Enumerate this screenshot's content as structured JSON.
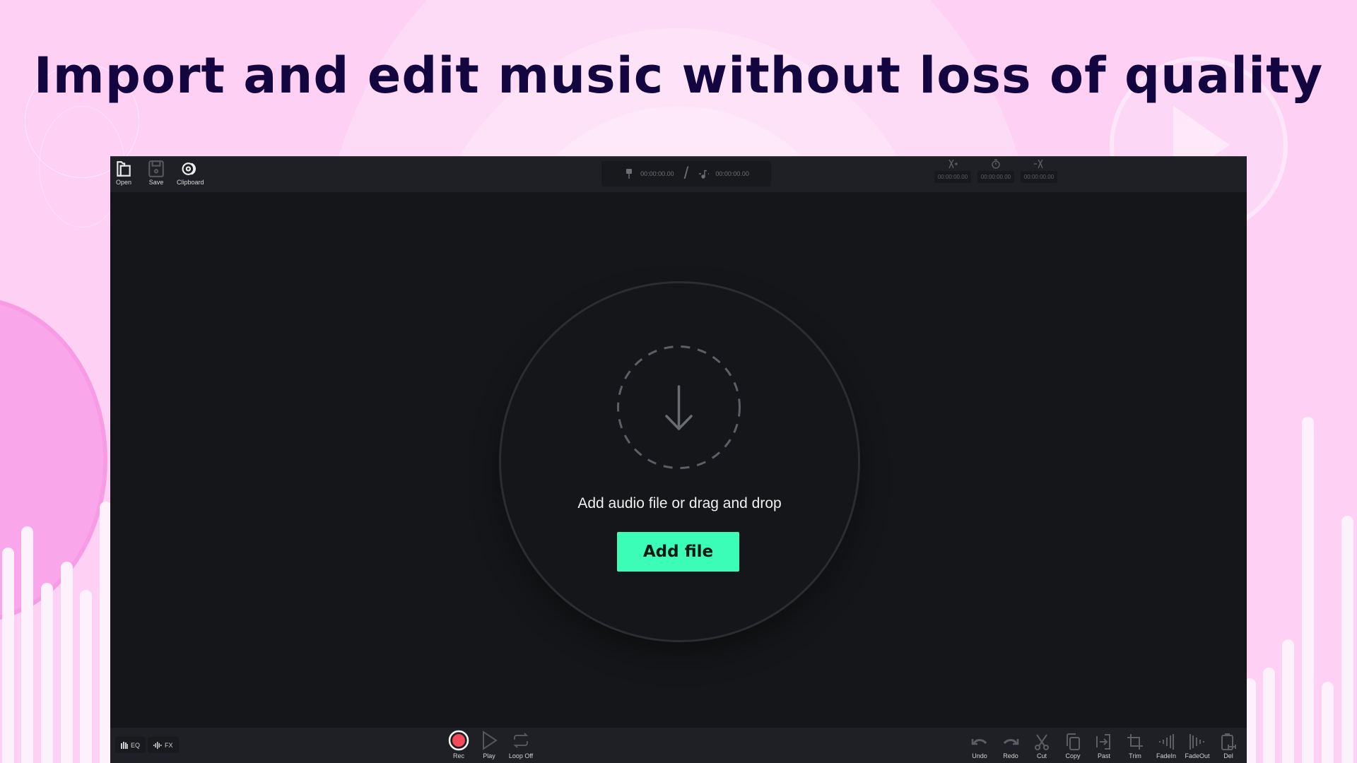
{
  "headline": "Import and edit music without loss of quality",
  "colors": {
    "background": "#fdd0f4",
    "headline": "#13053f",
    "app_bg": "#151619",
    "toolbar_bg": "#1f2025",
    "accent_button": "#3cfdb8",
    "record_red": "#f24b57"
  },
  "toolbar_left": [
    {
      "label": "Open",
      "icon": "folder-open-icon"
    },
    {
      "label": "Save",
      "icon": "save-disk-icon"
    },
    {
      "label": "Clipboard",
      "icon": "clipboard-disc-icon"
    }
  ],
  "time_display": {
    "position": "00:00:00.00",
    "duration": "00:00:00.00",
    "separator": "/"
  },
  "selection_times": {
    "start": "00:00:00.00",
    "length": "00:00:00.00",
    "end": "00:00:00.00"
  },
  "drop_zone": {
    "message": "Add audio file or drag and drop",
    "button_label": "Add file",
    "icon": "download-arrow-icon"
  },
  "bottom_left": [
    {
      "label": "EQ",
      "icon": "equalizer-icon"
    },
    {
      "label": "FX",
      "icon": "waveform-icon"
    }
  ],
  "transport": [
    {
      "label": "Rec",
      "icon": "record-icon"
    },
    {
      "label": "Play",
      "icon": "play-icon"
    },
    {
      "label": "Loop Off",
      "icon": "loop-icon"
    }
  ],
  "edit_tools": [
    {
      "label": "Undo",
      "icon": "undo-icon"
    },
    {
      "label": "Redo",
      "icon": "redo-icon"
    },
    {
      "label": "Cut",
      "icon": "scissors-icon"
    },
    {
      "label": "Copy",
      "icon": "copy-icon"
    },
    {
      "label": "Past",
      "icon": "paste-icon"
    },
    {
      "label": "Trim",
      "icon": "crop-icon"
    },
    {
      "label": "FadeIn",
      "icon": "fade-in-icon"
    },
    {
      "label": "FadeOut",
      "icon": "fade-out-icon"
    },
    {
      "label": "Del",
      "icon": "delete-icon"
    }
  ]
}
